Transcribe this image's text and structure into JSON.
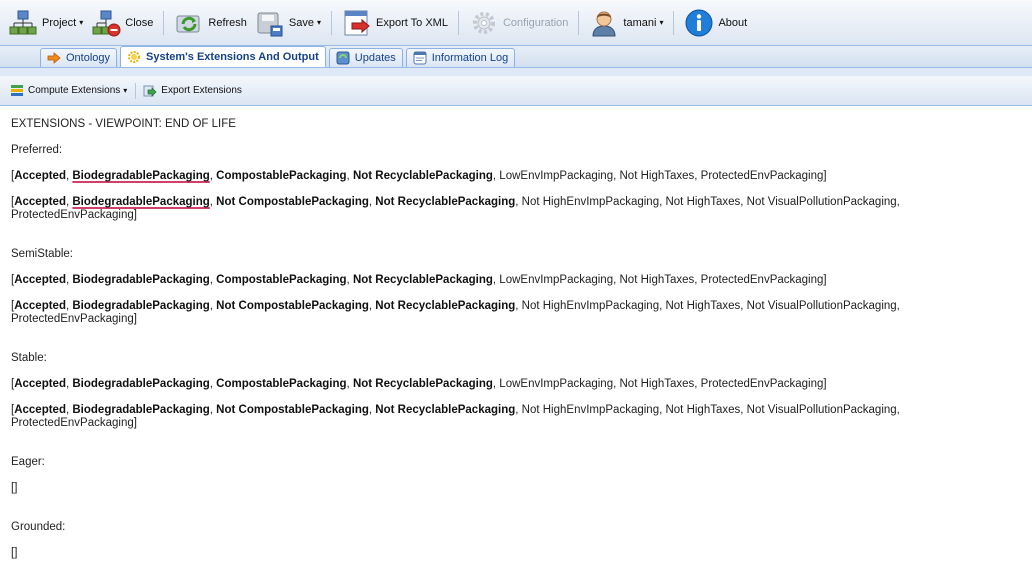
{
  "toolbar": {
    "project": "Project",
    "close": "Close",
    "refresh": "Refresh",
    "save": "Save",
    "export_xml": "Export To XML",
    "configuration": "Configuration",
    "user": "tamani",
    "about": "About"
  },
  "tabs": [
    {
      "label": "Ontology"
    },
    {
      "label": "System's Extensions And Output"
    },
    {
      "label": "Updates"
    },
    {
      "label": "Information Log"
    }
  ],
  "subbar": {
    "compute": "Compute Extensions",
    "export": "Export Extensions"
  },
  "content": {
    "title": "EXTENSIONS - VIEWPOINT: END OF LIFE",
    "sections": [
      {
        "label": "Preferred:",
        "ext1": {
          "open": "[",
          "b1": "Accepted",
          "b2": "BiodegradablePackaging",
          "b3": "CompostablePackaging",
          "b4": "Not RecyclablePackaging",
          "rest": ", LowEnvImpPackaging, Not HighTaxes, ProtectedEnvPackaging]"
        },
        "ext2": {
          "open": "[",
          "b1": "Accepted",
          "b2": "BiodegradablePackaging",
          "b3": "Not CompostablePackaging",
          "b4": "Not RecyclablePackaging",
          "rest": ", Not HighEnvImpPackaging, Not HighTaxes, Not VisualPollutionPackaging,",
          "cont": "ProtectedEnvPackaging]"
        }
      },
      {
        "label": "SemiStable:",
        "ext1": {
          "open": "[",
          "b1": "Accepted",
          "b2": "BiodegradablePackaging",
          "b3": "CompostablePackaging",
          "b4": "Not RecyclablePackaging",
          "rest": ", LowEnvImpPackaging, Not HighTaxes, ProtectedEnvPackaging]"
        },
        "ext2": {
          "open": "[",
          "b1": "Accepted",
          "b2": "BiodegradablePackaging",
          "b3": "Not CompostablePackaging",
          "b4": "Not RecyclablePackaging",
          "rest": ", Not HighEnvImpPackaging, Not HighTaxes, Not VisualPollutionPackaging,",
          "cont": "ProtectedEnvPackaging]"
        }
      },
      {
        "label": "Stable:",
        "ext1": {
          "open": "[",
          "b1": "Accepted",
          "b2": "BiodegradablePackaging",
          "b3": "CompostablePackaging",
          "b4": "Not RecyclablePackaging",
          "rest": ", LowEnvImpPackaging, Not HighTaxes, ProtectedEnvPackaging]"
        },
        "ext2": {
          "open": "[",
          "b1": "Accepted",
          "b2": "BiodegradablePackaging",
          "b3": "Not CompostablePackaging",
          "b4": "Not RecyclablePackaging",
          "rest": ", Not HighEnvImpPackaging, Not HighTaxes, Not VisualPollutionPackaging,",
          "cont": "ProtectedEnvPackaging]"
        }
      }
    ],
    "eager_label": "Eager:",
    "eager_value": "[]",
    "grounded_label": "Grounded:",
    "grounded_value": "[]"
  },
  "icons": {
    "project": "project-hierarchy-icon",
    "close": "close-project-icon",
    "refresh": "refresh-icon",
    "save": "save-disk-icon",
    "export_xml": "export-xml-icon",
    "configuration": "gear-icon",
    "user": "user-avatar-icon",
    "about": "info-icon"
  }
}
